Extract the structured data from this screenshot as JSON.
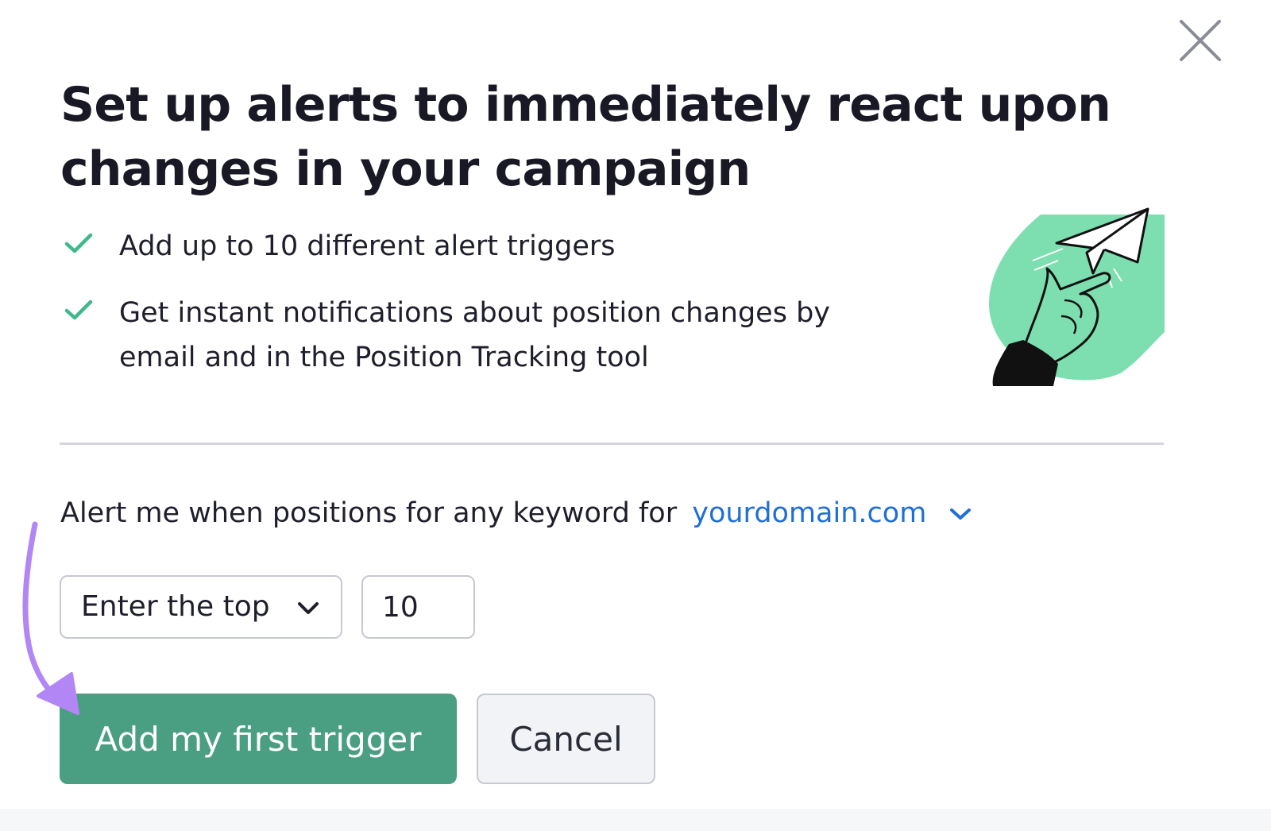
{
  "dialog": {
    "title_lines": [
      "Set up alerts to immediately react upon",
      "changes in your campaign"
    ],
    "close_icon": "close-icon"
  },
  "features": [
    {
      "icon": "check-icon",
      "lines": [
        "Add up to 10 different alert triggers"
      ]
    },
    {
      "icon": "check-icon",
      "lines": [
        "Get instant notifications about position changes by",
        "email and in the Position Tracking tool"
      ]
    }
  ],
  "illustration": {
    "icon": "paper-plane-hand-illustration"
  },
  "alert": {
    "prefix": "Alert me when positions for any keyword for",
    "domain": "yourdomain.com",
    "domain_icon": "chevron-down-icon"
  },
  "condition": {
    "select_value": "Enter the top",
    "select_icon": "chevron-down-icon",
    "number_value": "10"
  },
  "actions": {
    "primary_label": "Add my first trigger",
    "secondary_label": "Cancel"
  },
  "annotation": {
    "icon": "pointer-arrow-icon"
  },
  "colors": {
    "primary_button": "#4a9e82",
    "check": "#3fb98b",
    "link": "#1f6fd6",
    "illustration_bg": "#7ddfb0",
    "annotation_arrow": "#b287f5"
  }
}
